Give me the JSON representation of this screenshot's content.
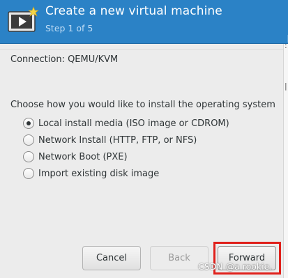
{
  "header": {
    "title": "Create a new virtual machine",
    "step": "Step 1 of 5"
  },
  "connection_label": "Connection:  QEMU/KVM",
  "install": {
    "question": "Choose how you would like to install the operating system",
    "options": [
      {
        "label": "Local install media (ISO image or CDROM)",
        "selected": true
      },
      {
        "label": "Network Install (HTTP, FTP, or NFS)",
        "selected": false
      },
      {
        "label": "Network Boot (PXE)",
        "selected": false
      },
      {
        "label": "Import existing disk image",
        "selected": false
      }
    ]
  },
  "buttons": {
    "cancel": "Cancel",
    "back": "Back",
    "forward": "Forward"
  },
  "watermark": "CSDN @a rookie.",
  "icon": "virtual-machine-icon",
  "colors": {
    "header_bg": "#2b82c6",
    "highlight": "#e0201b"
  }
}
